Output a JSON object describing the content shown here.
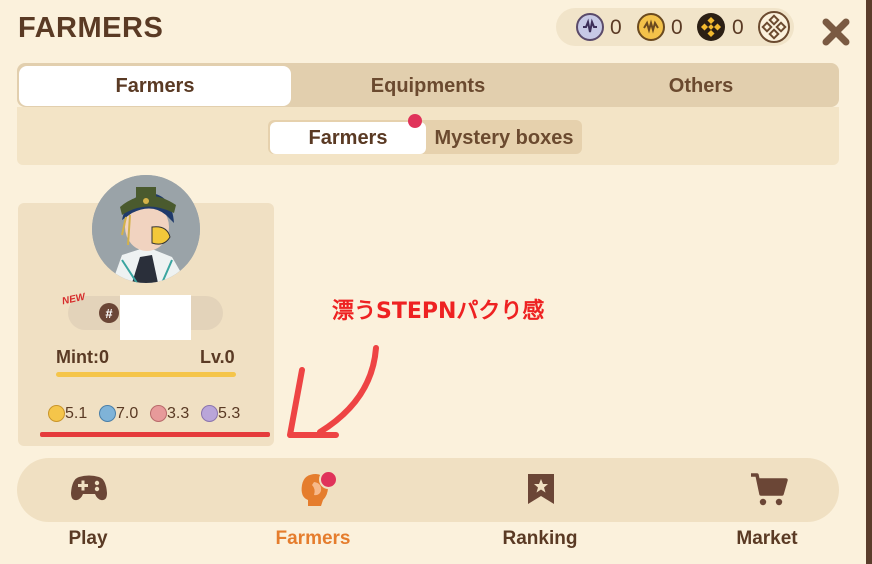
{
  "header": {
    "title": "FARMERS",
    "currencies": [
      {
        "icon": "m-coin-icon",
        "value": "0"
      },
      {
        "icon": "gold-coin-icon",
        "value": "0"
      },
      {
        "icon": "bnb-coin-icon",
        "value": "0"
      }
    ]
  },
  "tabs": [
    {
      "label": "Farmers",
      "active": true
    },
    {
      "label": "Equipments",
      "active": false
    },
    {
      "label": "Others",
      "active": false
    }
  ],
  "subtabs": [
    {
      "label": "Farmers",
      "active": true
    },
    {
      "label": "Mystery boxes",
      "active": false
    }
  ],
  "card": {
    "badge": "NEW",
    "id_prefix": "#",
    "mint": "Mint:0",
    "level": "Lv.0",
    "stats": [
      {
        "icon": "stat-yellow-icon",
        "value": "5.1",
        "color": "#f5c54a"
      },
      {
        "icon": "stat-blue-icon",
        "value": "7.0",
        "color": "#7fb3d8"
      },
      {
        "icon": "stat-pink-icon",
        "value": "3.3",
        "color": "#e79a9a"
      },
      {
        "icon": "stat-purple-icon",
        "value": "5.3",
        "color": "#b9a5d9"
      }
    ]
  },
  "annotation": {
    "text": "漂うSTEPNパクり感",
    "color": "#ee2222"
  },
  "nav": [
    {
      "label": "Play",
      "icon": "gamepad-icon",
      "active": false
    },
    {
      "label": "Farmers",
      "icon": "farmer-head-icon",
      "active": true
    },
    {
      "label": "Ranking",
      "icon": "bookmark-star-icon",
      "active": false
    },
    {
      "label": "Market",
      "icon": "cart-icon",
      "active": false
    }
  ],
  "colors": {
    "accent": "#e57d2d",
    "text": "#5a3a24",
    "background": "#fbf1dc",
    "notification": "#e0335a"
  }
}
